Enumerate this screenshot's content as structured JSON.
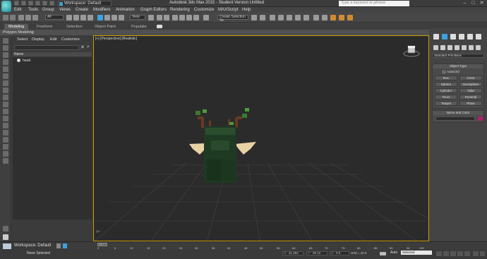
{
  "titlebar": {
    "workspace": "Workspace: Default",
    "title": "Autodesk 3ds Max 2015 - Student Version   Untitled",
    "search_placeholder": "Type a keyword or phrase",
    "min": "–",
    "max": "□",
    "close": "✕"
  },
  "menubar": {
    "items": [
      "Edit",
      "Tools",
      "Group",
      "Views",
      "Create",
      "Modifiers",
      "Animation",
      "Graph Editors",
      "Rendering",
      "Customize",
      "MAXScript",
      "Help"
    ]
  },
  "toolbar": {
    "selection_filter": "All",
    "ref_coord": "View",
    "named_selection": "Create Selection Se"
  },
  "ribbon": {
    "tabs": [
      "Modeling",
      "Freeform",
      "Selection",
      "Object Paint",
      "Populate"
    ],
    "active_tab": "Modeling",
    "sub_label": "Polygon Modeling"
  },
  "scene_explorer": {
    "menus": [
      "Select",
      "Display",
      "Edit",
      "Customize"
    ],
    "close_glyph": "✕",
    "search_glyph": "⌕",
    "column_header": "Name",
    "tree": [
      {
        "label": "head"
      }
    ]
  },
  "viewport": {
    "label": "[+] [Perspective] [Realistic]",
    "axis_glyph": "⊢"
  },
  "command_panel": {
    "dropdown": "Standard Primitives",
    "object_type_title": "Object Type",
    "autogrid": "AutoGrid",
    "primitives": [
      "Box",
      "Cone",
      "Sphere",
      "GeoSphere",
      "Cylinder",
      "Tube",
      "Torus",
      "Pyramid",
      "Teapot",
      "Plane"
    ],
    "name_color_title": "Name and Color"
  },
  "trackbar": {
    "workspace": "Workspace: Default",
    "time_slider": "0 / 100",
    "ticks": [
      "0",
      "5",
      "10",
      "15",
      "20",
      "25",
      "30",
      "35",
      "40",
      "45",
      "50",
      "55",
      "60",
      "65",
      "70",
      "75",
      "80",
      "85",
      "90",
      "95",
      "100"
    ]
  },
  "statusbar": {
    "status": "None Selected",
    "x_label": "X:",
    "x_value": "41.464",
    "y_label": "Y:",
    "y_value": "20.12",
    "z_label": "Z:",
    "z_value": "0.0",
    "grid": "Grid = 10.0",
    "auto": "Auto",
    "selection_mode": "Selected"
  },
  "colors": {
    "viewport_border": "#c8a000",
    "accent_magenta": "#b0206e",
    "app_cyan": "#1a8a92"
  }
}
